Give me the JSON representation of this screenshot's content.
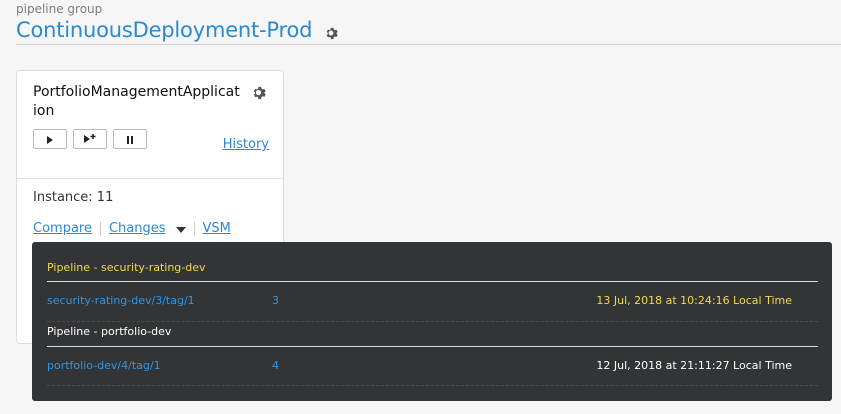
{
  "pipeline_group": {
    "label": "pipeline group",
    "name": "ContinuousDeployment-Prod",
    "settings_icon": "gear-icon"
  },
  "pipeline_card": {
    "name": "PortfolioManagementApplication",
    "settings_icon": "gear-icon",
    "buttons": [
      {
        "name": "trigger-button",
        "icon": "play-icon"
      },
      {
        "name": "trigger-with-options-button",
        "icon": "play-plus-icon"
      },
      {
        "name": "pause-button",
        "icon": "pause-icon"
      }
    ],
    "history_label": "History",
    "instance_text": "Instance: 11",
    "links": {
      "compare": "Compare",
      "changes": "Changes",
      "vsm": "VSM"
    }
  },
  "changes_popup": {
    "colors": {
      "background": "#333435",
      "highlight": "#f0d94c",
      "link": "#2f95e6",
      "text": "#ffffff"
    },
    "groups": [
      {
        "heading": "Pipeline - security-rating-dev",
        "highlighted": true,
        "row": {
          "revision": "security-rating-dev/3/tag/1",
          "counter": "3",
          "modified": "13 Jul, 2018 at 10:24:16 Local Time"
        }
      },
      {
        "heading": "Pipeline - portfolio-dev",
        "highlighted": false,
        "row": {
          "revision": "portfolio-dev/4/tag/1",
          "counter": "4",
          "modified": "12 Jul, 2018 at 21:11:27 Local Time"
        }
      }
    ]
  }
}
